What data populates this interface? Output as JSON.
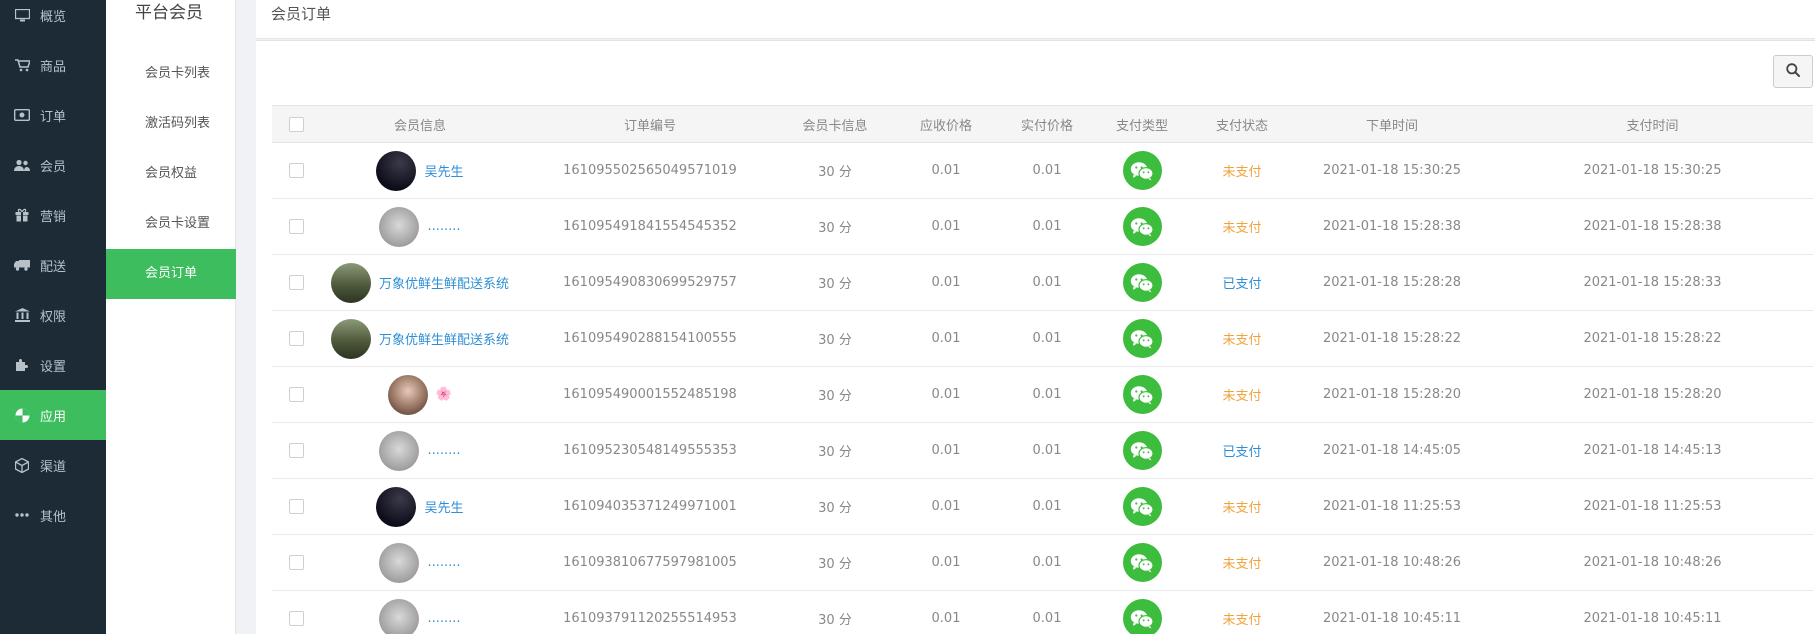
{
  "sidebar": {
    "items": [
      {
        "label": "概览",
        "icon": "monitor-icon"
      },
      {
        "label": "商品",
        "icon": "cart-icon"
      },
      {
        "label": "订单",
        "icon": "money-icon"
      },
      {
        "label": "会员",
        "icon": "users-icon"
      },
      {
        "label": "营销",
        "icon": "gift-icon"
      },
      {
        "label": "配送",
        "icon": "truck-icon"
      },
      {
        "label": "权限",
        "icon": "bank-icon"
      },
      {
        "label": "设置",
        "icon": "puzzle-icon"
      },
      {
        "label": "应用",
        "icon": "pie-icon"
      },
      {
        "label": "渠道",
        "icon": "cube-icon"
      },
      {
        "label": "其他",
        "icon": "ellipsis-icon"
      }
    ],
    "active": "应用"
  },
  "subnav": {
    "title": "平台会员",
    "items": [
      "会员卡列表",
      "激活码列表",
      "会员权益",
      "会员卡设置",
      "会员订单"
    ],
    "active": "会员订单"
  },
  "page": {
    "title": "会员订单",
    "search_icon": "search-icon"
  },
  "table": {
    "headers": [
      "会员信息",
      "订单编号",
      "会员卡信息",
      "应收价格",
      "实付价格",
      "支付类型",
      "支付状态",
      "下单时间",
      "支付时间"
    ],
    "rows": [
      {
        "name": "吴先生",
        "avatar": "dark",
        "order_no": "161095502565049571019",
        "card": "30 分",
        "due": "0.01",
        "paid": "0.01",
        "pay_type": "wechat-pay-icon",
        "status": "未支付",
        "order_time": "2021-01-18 15:30:25",
        "pay_time": "2021-01-18 15:30:25"
      },
      {
        "name": "........",
        "avatar": "grey",
        "order_no": "161095491841554545352",
        "card": "30 分",
        "due": "0.01",
        "paid": "0.01",
        "pay_type": "wechat-pay-icon",
        "status": "未支付",
        "order_time": "2021-01-18 15:28:38",
        "pay_time": "2021-01-18 15:28:38"
      },
      {
        "name": "万象优鲜生鲜配送系统",
        "avatar": "scene",
        "order_no": "161095490830699529757",
        "card": "30 分",
        "due": "0.01",
        "paid": "0.01",
        "pay_type": "wechat-pay-icon",
        "status": "已支付",
        "order_time": "2021-01-18 15:28:28",
        "pay_time": "2021-01-18 15:28:33"
      },
      {
        "name": "万象优鲜生鲜配送系统",
        "avatar": "scene",
        "order_no": "161095490288154100555",
        "card": "30 分",
        "due": "0.01",
        "paid": "0.01",
        "pay_type": "wechat-pay-icon",
        "status": "未支付",
        "order_time": "2021-01-18 15:28:22",
        "pay_time": "2021-01-18 15:28:22"
      },
      {
        "name": "🌸",
        "avatar": "photo",
        "order_no": "161095490001552485198",
        "card": "30 分",
        "due": "0.01",
        "paid": "0.01",
        "pay_type": "wechat-pay-icon",
        "status": "未支付",
        "order_time": "2021-01-18 15:28:20",
        "pay_time": "2021-01-18 15:28:20"
      },
      {
        "name": "........",
        "avatar": "grey",
        "order_no": "161095230548149555353",
        "card": "30 分",
        "due": "0.01",
        "paid": "0.01",
        "pay_type": "wechat-pay-icon",
        "status": "已支付",
        "order_time": "2021-01-18 14:45:05",
        "pay_time": "2021-01-18 14:45:13"
      },
      {
        "name": "吴先生",
        "avatar": "dark",
        "order_no": "161094035371249971001",
        "card": "30 分",
        "due": "0.01",
        "paid": "0.01",
        "pay_type": "wechat-pay-icon",
        "status": "未支付",
        "order_time": "2021-01-18 11:25:53",
        "pay_time": "2021-01-18 11:25:53"
      },
      {
        "name": "........",
        "avatar": "grey",
        "order_no": "161093810677597981005",
        "card": "30 分",
        "due": "0.01",
        "paid": "0.01",
        "pay_type": "wechat-pay-icon",
        "status": "未支付",
        "order_time": "2021-01-18 10:48:26",
        "pay_time": "2021-01-18 10:48:26"
      },
      {
        "name": "........",
        "avatar": "grey",
        "order_no": "161093791120255514953",
        "card": "30 分",
        "due": "0.01",
        "paid": "0.01",
        "pay_type": "wechat-pay-icon",
        "status": "未支付",
        "order_time": "2021-01-18 10:45:11",
        "pay_time": "2021-01-18 10:45:11"
      }
    ]
  },
  "colors": {
    "sidebar_bg": "#1c2b36",
    "accent_green": "#3dbd5e",
    "wechat_green": "#3dbd3d",
    "link_blue": "#2f8fd6",
    "unpaid_orange": "#f0a33a"
  }
}
